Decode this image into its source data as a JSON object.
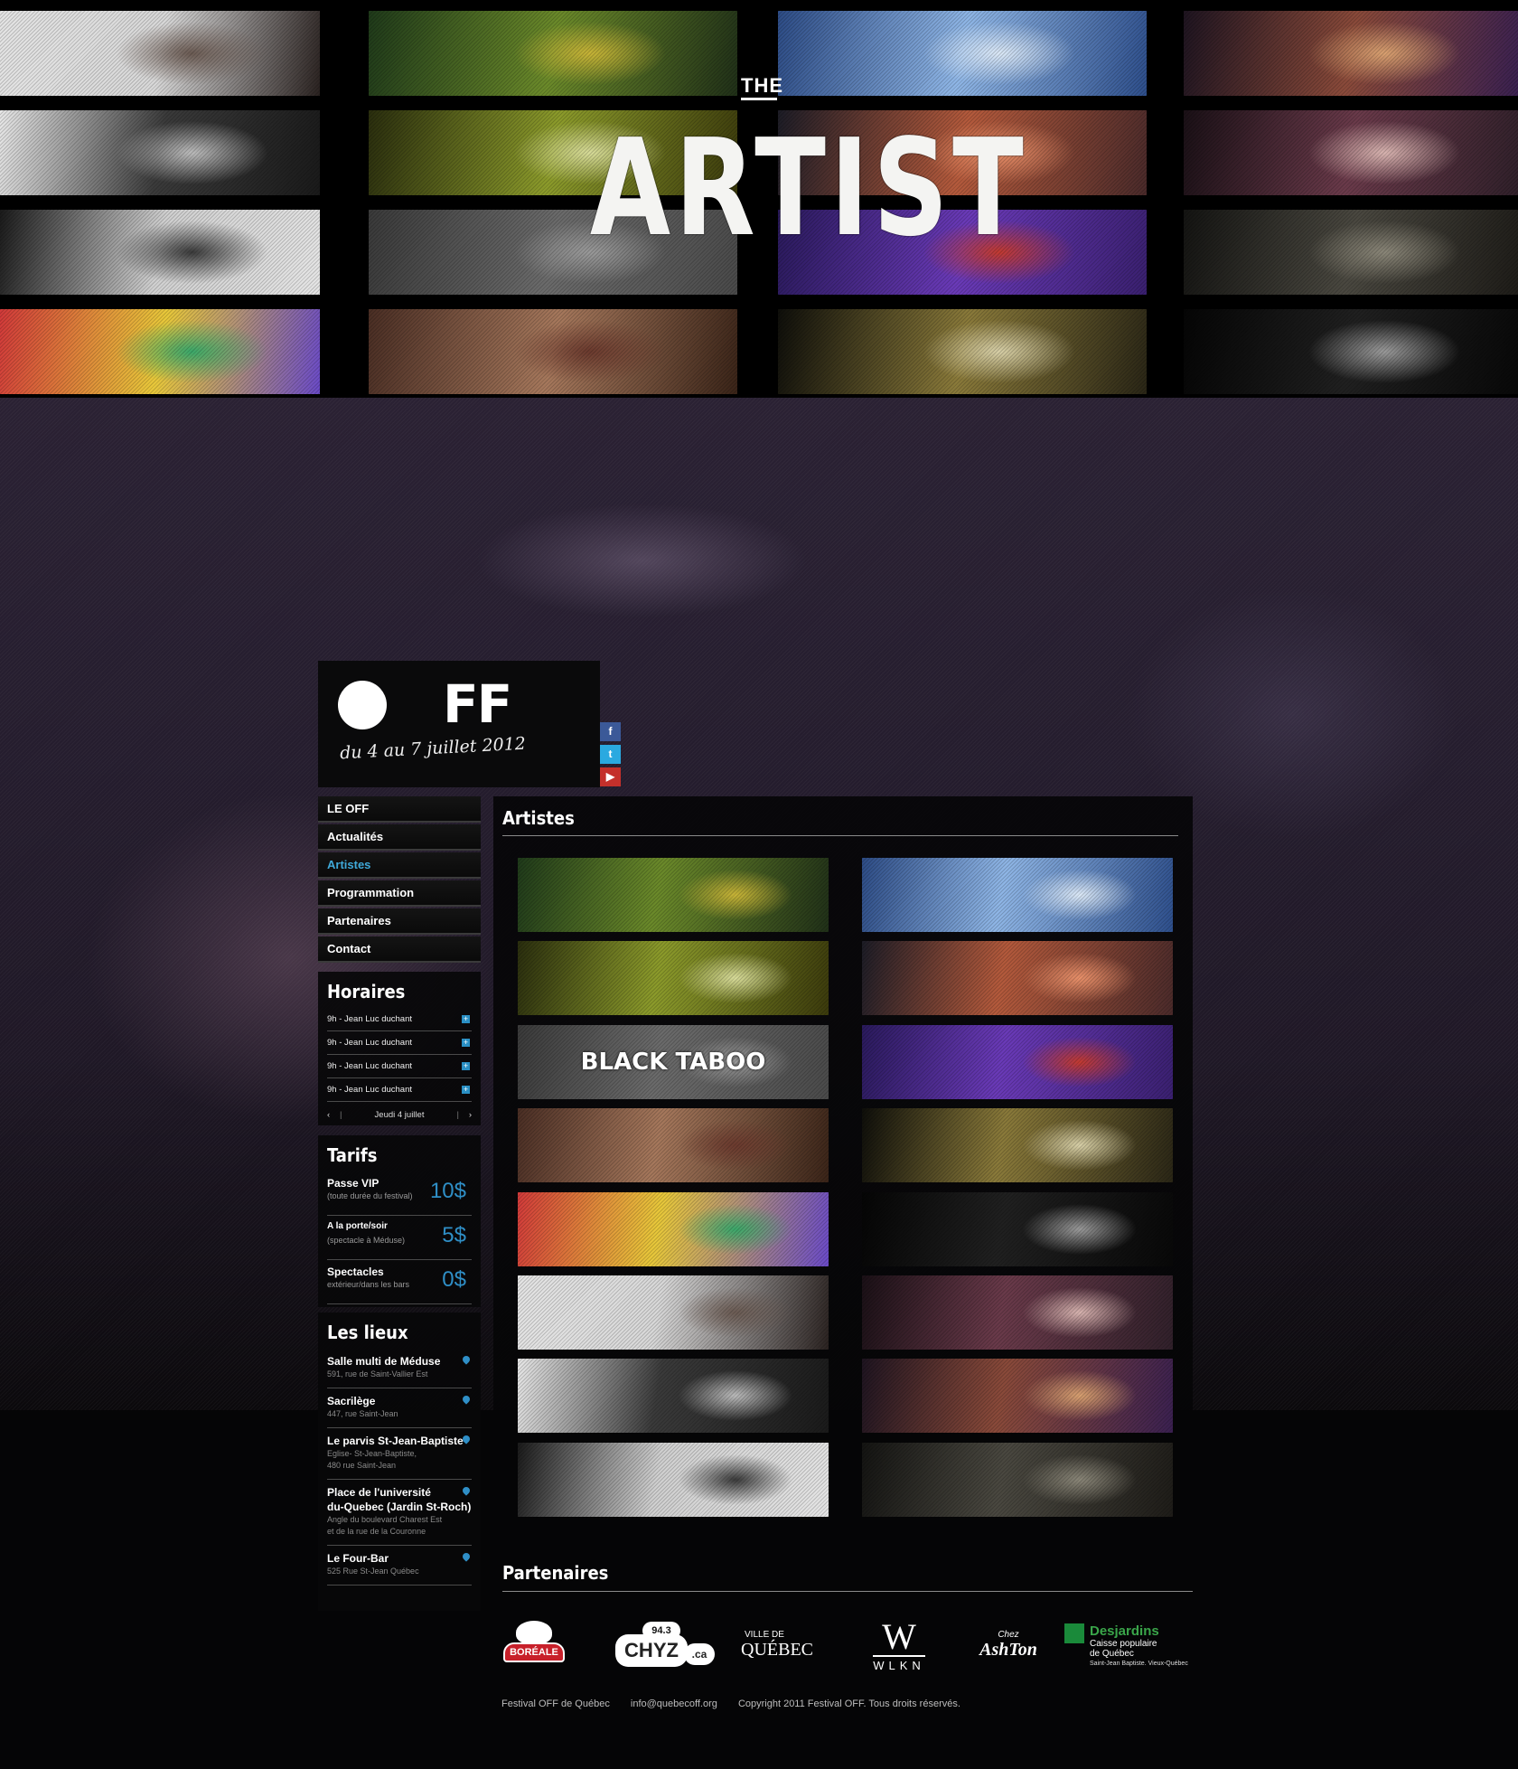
{
  "header": {
    "the": "THE",
    "title": "ARTIST"
  },
  "logo": {
    "off_letters": "FF",
    "dates": "du 4 au 7 juillet 2012"
  },
  "social": [
    {
      "icon": "facebook-icon",
      "glyph": "f",
      "color": "#3b5998"
    },
    {
      "icon": "twitter-icon",
      "glyph": "t",
      "color": "#2aa9e0"
    },
    {
      "icon": "youtube-icon",
      "glyph": "▶",
      "color": "#c4302b"
    }
  ],
  "nav": [
    "LE OFF",
    "Actualités",
    "Artistes",
    "Programmation",
    "Partenaires",
    "Contact"
  ],
  "nav_active": "Artistes",
  "horaires": {
    "title": "Horaires",
    "rows": [
      "9h  -  Jean Luc duchant",
      "9h  -  Jean Luc duchant",
      "9h  -  Jean Luc duchant",
      "9h  -  Jean Luc duchant"
    ],
    "day": "Jeudi 4 juillet",
    "prev": "‹",
    "next": "›"
  },
  "tarifs": {
    "title": "Tarifs",
    "items": [
      {
        "name": "Passe VIP",
        "sub": "(toute durée du festival)",
        "price": "10$"
      },
      {
        "name": "A la porte/soir",
        "sub": "(spectacle à Méduse)",
        "price": "5$"
      },
      {
        "name": "Spectacles",
        "sub": "extérieur/dans les bars",
        "price": "0$"
      }
    ]
  },
  "lieux": {
    "title": "Les lieux",
    "items": [
      {
        "name": "Salle multi de Méduse",
        "address": "591, rue de Saint-Vallier Est"
      },
      {
        "name": "Sacrilège",
        "address": "447, rue Saint-Jean"
      },
      {
        "name": "Le parvis St-Jean-Baptiste",
        "address": "Eglise- St-Jean-Baptiste,\n480 rue Saint-Jean"
      },
      {
        "name": "Place de l'université\ndu-Quebec (Jardin St-Roch)",
        "address": "Angle du boulevard Charest Est\net de la rue de la Couronne"
      },
      {
        "name": "Le Four-Bar",
        "address": "525 Rue St-Jean Québec"
      }
    ]
  },
  "artistes": {
    "title": "Artistes",
    "thumbs": [
      {
        "label": "",
        "colors": [
          "#1f3a1a",
          "#6b8a2a",
          "#c8b437",
          "#203018"
        ]
      },
      {
        "label": "",
        "colors": [
          "#2d4c86",
          "#8fb6e6",
          "#dbe8f6",
          "#2e4f8c"
        ]
      },
      {
        "label": "",
        "colors": [
          "#2a2e0e",
          "#8c9b2b",
          "#d8dc9a",
          "#3b3a0c"
        ]
      },
      {
        "label": "",
        "colors": [
          "#1c1c26",
          "#b45a3c",
          "#e8906a",
          "#4a2a2a"
        ]
      },
      {
        "label": "BLACK TABOO",
        "colors": [
          "#3a3a3a",
          "#6b6b6b",
          "#9a9a9a",
          "#4a4a4a"
        ]
      },
      {
        "label": "",
        "colors": [
          "#2a1a5c",
          "#6a3ab8",
          "#c23a30",
          "#3a2070"
        ]
      },
      {
        "label": "",
        "colors": [
          "#4a2e24",
          "#a6785c",
          "#6b3a2e",
          "#3a2418"
        ]
      },
      {
        "label": "",
        "colors": [
          "#0e0e0a",
          "#8a7a3a",
          "#d8d0a8",
          "#2a2616"
        ]
      },
      {
        "label": "",
        "colors": [
          "#d23a3a",
          "#e8c83a",
          "#3aa86a",
          "#6a4ac8"
        ]
      },
      {
        "label": "",
        "colors": [
          "#050505",
          "#202020",
          "#9a9a9a",
          "#080808"
        ]
      },
      {
        "label": "",
        "colors": [
          "#e4e4e4",
          "#d8d8d8",
          "#6a5a52",
          "#2a2220"
        ]
      },
      {
        "label": "",
        "colors": [
          "#1a1016",
          "#6a3a4a",
          "#d8b4b0",
          "#30202a"
        ]
      },
      {
        "label": "",
        "colors": [
          "#e8e8e8",
          "#3a3a3a",
          "#bcbcbc",
          "#1a1a1a"
        ]
      },
      {
        "label": "",
        "colors": [
          "#1e1420",
          "#8a4a3a",
          "#d8a070",
          "#3a2050"
        ]
      },
      {
        "label": "",
        "colors": [
          "#1a1a1a",
          "#d0d0d0",
          "#3a3a3a",
          "#e4e4e4"
        ]
      },
      {
        "label": "",
        "colors": [
          "#141412",
          "#4a4840",
          "#8a8678",
          "#1e1c18"
        ]
      }
    ]
  },
  "partenaires": {
    "title": "Partenaires",
    "logos": [
      {
        "name": "boreale-logo",
        "text": "BORÉALE"
      },
      {
        "name": "chyz-logo",
        "text": "CHYZ",
        "extra": "94.3",
        "suffix": ".ca"
      },
      {
        "name": "ville-de-quebec-logo",
        "text": "QUÉBEC",
        "extra": "VILLE DE"
      },
      {
        "name": "wlkn-logo",
        "text": "W",
        "extra": "WLKN"
      },
      {
        "name": "ashton-logo",
        "text": "AshTon",
        "extra": "Chez"
      },
      {
        "name": "desjardins-logo",
        "text": "Desjardins",
        "extra": "Caisse populaire\nde Québec",
        "suffix": "Saint-Jean Baptiste. Vieux-Québec"
      }
    ]
  },
  "footer": {
    "name": "Festival OFF de Québec",
    "email": "info@quebecoff.org",
    "copyright": "Copyright 2011 Festival OFF. Tous droits réservés."
  }
}
